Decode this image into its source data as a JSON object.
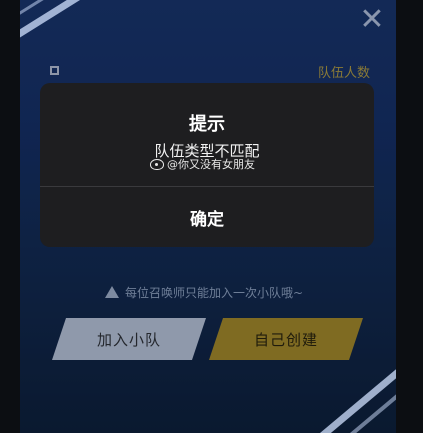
{
  "background": {
    "close_symbol": "✕",
    "team_count_label": "队伍人数",
    "hint_text": "每位召唤师只能加入一次小队哦~",
    "join_team_label": "加入小队",
    "create_team_label": "自己创建",
    "colors": {
      "panel": "#173471",
      "create_button": "#7f6b22",
      "join_button": "#8f99ab"
    }
  },
  "dialog": {
    "title": "提示",
    "message": "队伍类型不匹配",
    "confirm_label": "确定",
    "colors": {
      "background": "#1e1e20"
    }
  },
  "watermark": {
    "icon": "weibo-icon",
    "text": "@你又没有女朋友"
  }
}
